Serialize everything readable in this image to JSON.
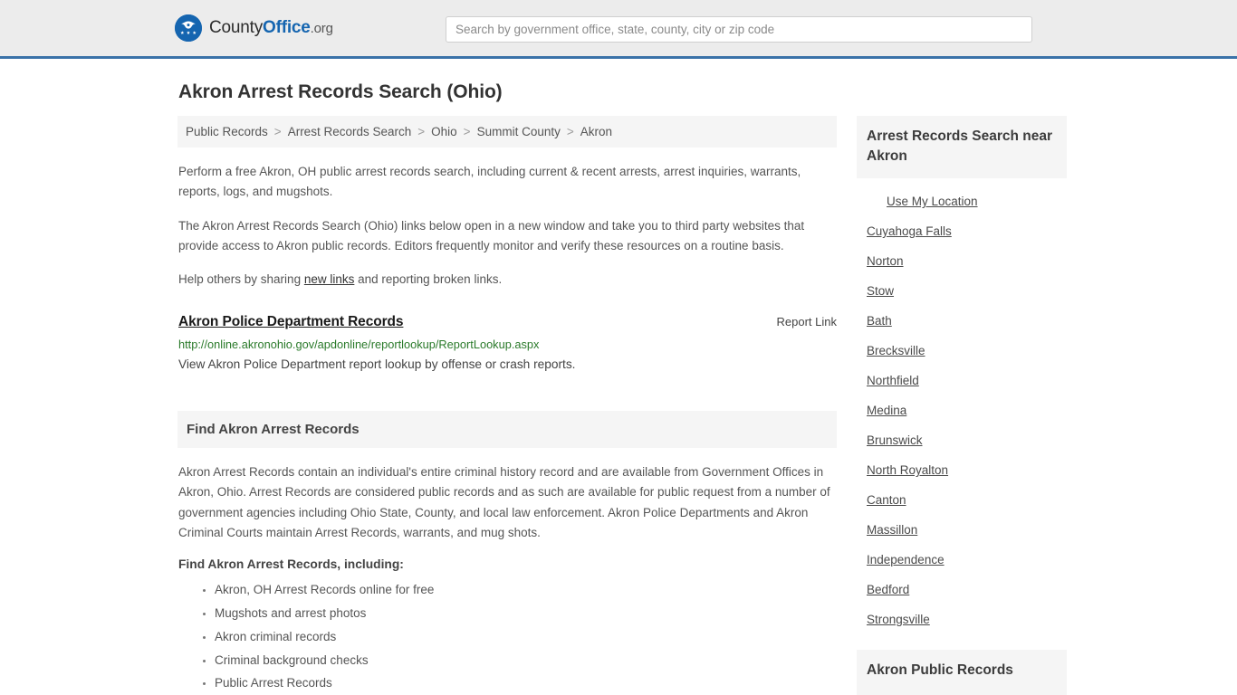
{
  "header": {
    "logo_icon": "eagle-shield-icon",
    "brand_county": "County",
    "brand_office": "Office",
    "brand_org": ".org",
    "search_placeholder": "Search by government office, state, county, city or zip code",
    "search_value": "",
    "accent_color": "#3a72a8",
    "background_color": "#ececec"
  },
  "page": {
    "title": "Akron Arrest Records Search (Ohio)"
  },
  "breadcrumb": [
    {
      "label": "Public Records"
    },
    {
      "label": "Arrest Records Search"
    },
    {
      "label": "Ohio"
    },
    {
      "label": "Summit County"
    },
    {
      "label": "Akron"
    }
  ],
  "breadcrumb_separator": ">",
  "intro": {
    "p1": "Perform a free Akron, OH public arrest records search, including current & recent arrests, arrest inquiries, warrants, reports, logs, and mugshots.",
    "p2": "The Akron Arrest Records Search (Ohio) links below open in a new window and take you to third party websites that provide access to Akron public records. Editors frequently monitor and verify these resources on a routine basis.",
    "p3_before": "Help others by sharing ",
    "p3_link": "new links",
    "p3_after": " and reporting broken links."
  },
  "result": {
    "title": "Akron Police Department Records",
    "report_label": "Report Link",
    "url": "http://online.akronohio.gov/apdonline/reportlookup/ReportLookup.aspx",
    "url_color": "#2a7a2a",
    "description": "View Akron Police Department report lookup by offense or crash reports."
  },
  "section": {
    "heading": "Find Akron Arrest Records",
    "paragraph": "Akron Arrest Records contain an individual's entire criminal history record and are available from Government Offices in Akron, Ohio. Arrest Records are considered public records and as such are available for public request from a number of government agencies including Ohio State, County, and local law enforcement. Akron Police Departments and Akron Criminal Courts maintain Arrest Records, warrants, and mug shots.",
    "sub_heading": "Find Akron Arrest Records, including:",
    "bullets": [
      "Akron, OH Arrest Records online for free",
      "Mugshots and arrest photos",
      "Akron criminal records",
      "Criminal background checks",
      "Public Arrest Records"
    ]
  },
  "sidebar": {
    "heading": "Arrest Records Search near Akron",
    "use_location": "Use My Location",
    "nearby": [
      "Cuyahoga Falls",
      "Norton",
      "Stow",
      "Bath",
      "Brecksville",
      "Northfield",
      "Medina",
      "Brunswick",
      "North Royalton",
      "Canton",
      "Massillon",
      "Independence",
      "Bedford",
      "Strongsville"
    ],
    "second_heading": "Akron Public Records"
  }
}
